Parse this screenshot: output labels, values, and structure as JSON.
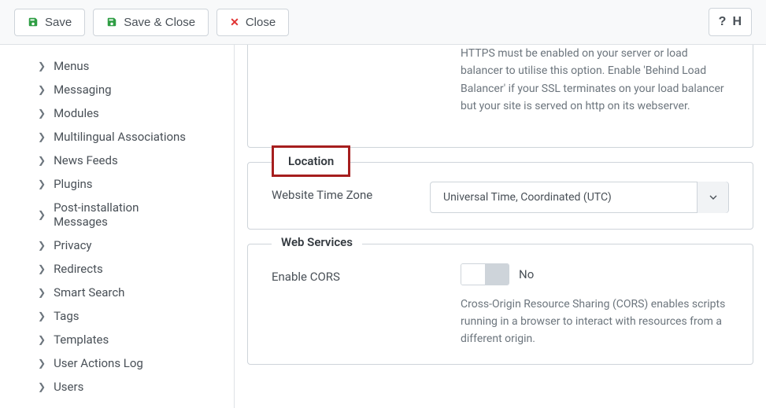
{
  "toolbar": {
    "save": "Save",
    "save_close": "Save & Close",
    "close": "Close",
    "help_trunc": "H"
  },
  "sidebar": {
    "items": [
      "Menus",
      "Messaging",
      "Modules",
      "Multilingual Associations",
      "News Feeds",
      "Plugins",
      "Post-installation Messages",
      "Privacy",
      "Redirects",
      "Smart Search",
      "Tags",
      "Templates",
      "User Actions Log",
      "Users"
    ]
  },
  "panel_top": {
    "desc": "HTTPS must be enabled on your server or load balancer to utilise this option. Enable 'Behind Load Balancer' if your SSL terminates on your load balancer but your site is served on http on its webserver."
  },
  "location": {
    "legend": "Location",
    "tz_label": "Website Time Zone",
    "tz_value": "Universal Time, Coordinated (UTC)"
  },
  "webservices": {
    "legend": "Web Services",
    "cors_label": "Enable CORS",
    "cors_value": "No",
    "cors_desc": "Cross-Origin Resource Sharing (CORS) enables scripts running in a browser to interact with resources from a different origin."
  }
}
